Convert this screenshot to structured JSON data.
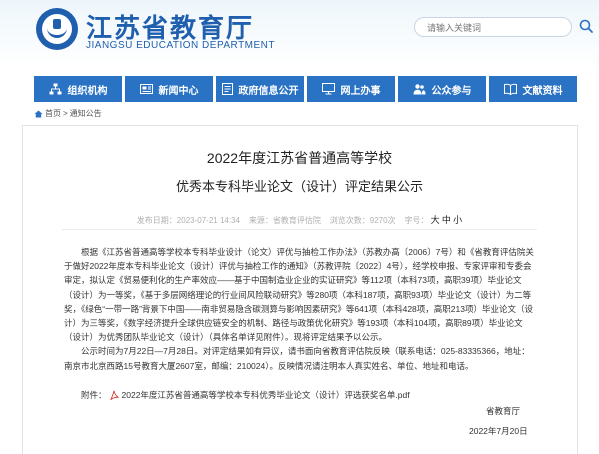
{
  "header": {
    "title": "江苏省教育厅",
    "subtitle": "JIANGSU EDUCATION DEPARTMENT",
    "search_placeholder": "请输入关键词"
  },
  "nav": [
    {
      "label": "组织机构",
      "icon": "sitemap-icon"
    },
    {
      "label": "新闻中心",
      "icon": "news-icon"
    },
    {
      "label": "政府信息公开",
      "icon": "document-icon"
    },
    {
      "label": "网上办事",
      "icon": "monitor-icon"
    },
    {
      "label": "公众参与",
      "icon": "people-icon"
    },
    {
      "label": "文献资料",
      "icon": "book-icon"
    }
  ],
  "breadcrumb": {
    "home": "首页",
    "sep": ">",
    "current": "通知公告"
  },
  "article": {
    "title_line1": "2022年度江苏省普通高等学校",
    "title_line2": "优秀本专科毕业论文（设计）评定结果公示",
    "meta_date": "发布日期：2023-07-21 14:34",
    "meta_source": "来源：省教育评估院",
    "meta_views": "浏览次数：9270次",
    "font_label": "字号：",
    "font_large": "大",
    "font_medium": "中",
    "font_small": "小",
    "paragraph1": "根据《江苏省普通高等学校本专科毕业设计（论文）评优与抽检工作办法》（苏教办高〔2006〕7号）和《省教育评估院关于做好2022年度本专科毕业论文（设计）评优与抽检工作的通知》（苏教评院〔2022〕4号），经学校申报、专家评审和专委会审定，拟认定《贸易便利化的生产率效应——基于中国制造业企业的实证研究》等112项（本科73项，高职39项）毕业论文（设计）为一等奖，《基于多层网络理论的行业间风险联动研究》等280项（本科187项，高职93项）毕业论文（设计）为二等奖，《绿色“一带一路”背景下中国——南非贸易隐含碳测算与影响因素研究》等641项（本科428项，高职213项）毕业论文（设计）为三等奖，《数字经济提升全球供应链安全的机制、路径与政策优化研究》等193项（本科104项，高职89项）毕业论文（设计）为优秀团队毕业论文（设计）（具体名单详见附件）。现将评定结果予以公示。",
    "paragraph2": "公示时间为7月22日—7月28日。对评定结果如有异议，请书面向省教育评估院反映（联系电话：025-83335366，地址：南京市北京西路15号教育大厦2607室，邮编：210024）。反映情况请注明本人真实姓名、单位、地址和电话。",
    "attachment_label": "附件：",
    "attachment_file": "2022年度江苏省普通高等学校本专科优秀毕业论文（设计）评选获奖名单.pdf",
    "signature_org": "省教育厅",
    "signature_date": "2022年7月20日"
  },
  "colors": {
    "brand": "#1f5fae",
    "nav_bg": "#2a72c4",
    "meta_text": "#b0b0b0"
  }
}
